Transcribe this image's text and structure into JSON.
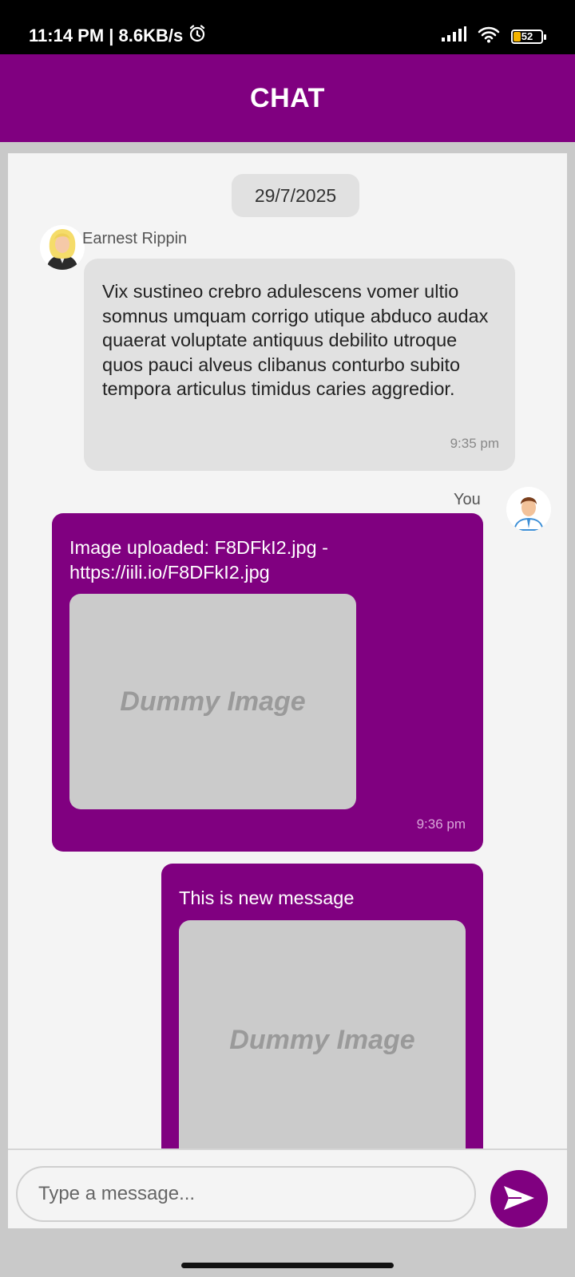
{
  "status_bar": {
    "time_speed": "11:14 PM | 8.6KB/s",
    "battery_level": "52"
  },
  "header": {
    "title": "CHAT"
  },
  "chat": {
    "date": "29/7/2025",
    "messages": [
      {
        "sender": "Earnest Rippin",
        "text": "Vix sustineo crebro adulescens vomer ultio somnus umquam corrigo utique abduco audax quaerat voluptate antiquus debilito utroque quos pauci alveus clibanus conturbo subito tempora articulus timidus caries aggredior.",
        "time": "9:35 pm"
      },
      {
        "sender": "You",
        "text": "Image uploaded: F8DFkI2.jpg - https://iili.io/F8DFkI2.jpg",
        "image_label": "Dummy Image",
        "time": "9:36 pm"
      },
      {
        "text": "This is new message",
        "image_label": "Dummy Image"
      }
    ]
  },
  "input": {
    "placeholder": "Type a message..."
  },
  "colors": {
    "primary": "#800080",
    "incoming_bubble": "#e1e1e1",
    "background": "#f4f4f4"
  },
  "icons": {
    "alarm": "alarm-icon",
    "signal": "signal-icon",
    "wifi": "wifi-icon",
    "battery": "battery-icon",
    "send": "send-icon"
  }
}
